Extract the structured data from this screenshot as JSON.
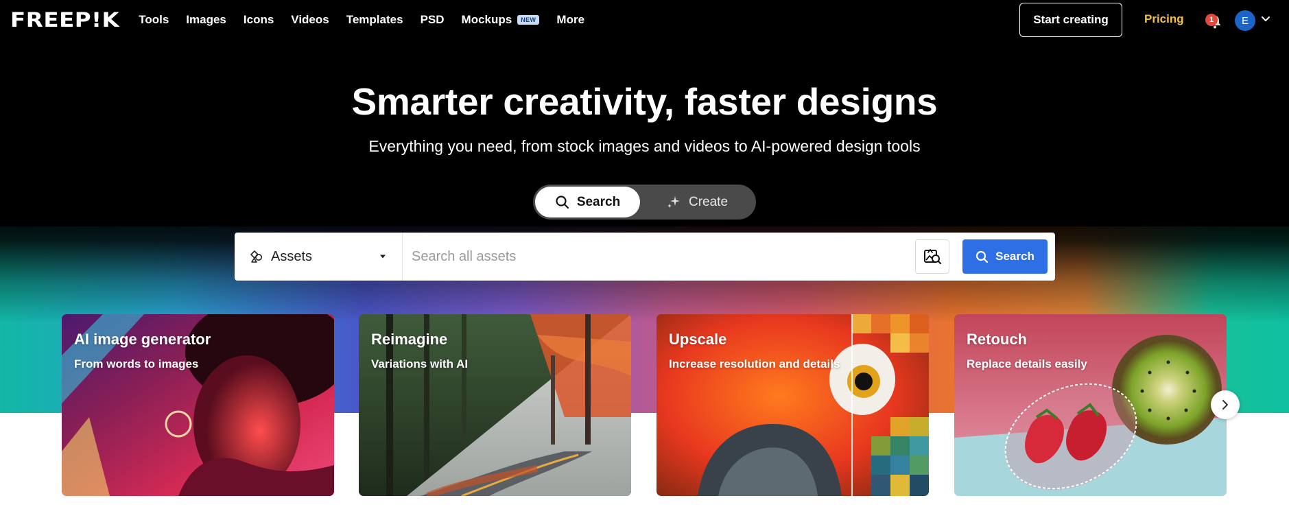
{
  "brand": {
    "logo_text": "FREEP!K"
  },
  "nav": {
    "items": [
      {
        "label": "Tools"
      },
      {
        "label": "Images"
      },
      {
        "label": "Icons"
      },
      {
        "label": "Videos"
      },
      {
        "label": "Templates"
      },
      {
        "label": "PSD"
      },
      {
        "label": "Mockups",
        "badge": "NEW"
      },
      {
        "label": "More"
      }
    ],
    "start_creating": "Start creating",
    "pricing": "Pricing",
    "notification_count": "1",
    "avatar_initial": "E"
  },
  "hero": {
    "title": "Smarter creativity, faster designs",
    "subtitle": "Everything you need, from stock images and videos to AI-powered design tools"
  },
  "mode_toggle": {
    "search": "Search",
    "create": "Create",
    "active": "search"
  },
  "search": {
    "asset_type": "Assets",
    "placeholder": "Search all assets",
    "button": "Search"
  },
  "cards": [
    {
      "title": "AI image generator",
      "subtitle": "From words to images"
    },
    {
      "title": "Reimagine",
      "subtitle": "Variations with AI"
    },
    {
      "title": "Upscale",
      "subtitle": "Increase resolution and details"
    },
    {
      "title": "Retouch",
      "subtitle": "Replace details easily"
    }
  ],
  "colors": {
    "background": "#000000",
    "accent_blue": "#2f6fe6",
    "pricing": "#f5c242",
    "notification": "#e14a3c"
  },
  "icons": [
    "bell-icon",
    "chevron-down-icon",
    "search-icon",
    "sparkle-icon",
    "assets-icon",
    "caret-down-icon",
    "image-search-icon",
    "chevron-right-icon"
  ]
}
